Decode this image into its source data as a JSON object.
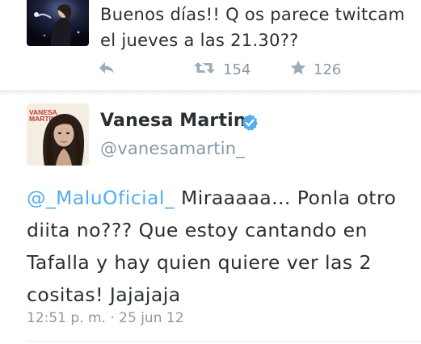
{
  "previous_tweet": {
    "text": "Buenos días!! Q os parece twitcam el jueves a las 21.30??",
    "retweet_count": "154",
    "favorite_count": "126",
    "icons": {
      "reply": "reply-icon",
      "retweet": "retweet-icon",
      "favorite": "star-icon"
    }
  },
  "tweet": {
    "author": {
      "display_name": "Vanesa Martin",
      "handle": "@vanesamartin_",
      "verified": true,
      "avatar_caption": "VANESA MARTIN"
    },
    "mention": "@_MaluOficial_",
    "body": " Miraaaaa... Ponla otro diita no??? Que estoy cantando en Tafalla y hay quien quiere ver las 2 cositas! Jajajaja",
    "timestamp": "12:51 p. m. · 25 jun 12"
  },
  "colors": {
    "text": "#292f33",
    "secondary": "#8899a6",
    "link": "#55acee",
    "verified": "#55acee",
    "divider": "#e1e8ed"
  }
}
